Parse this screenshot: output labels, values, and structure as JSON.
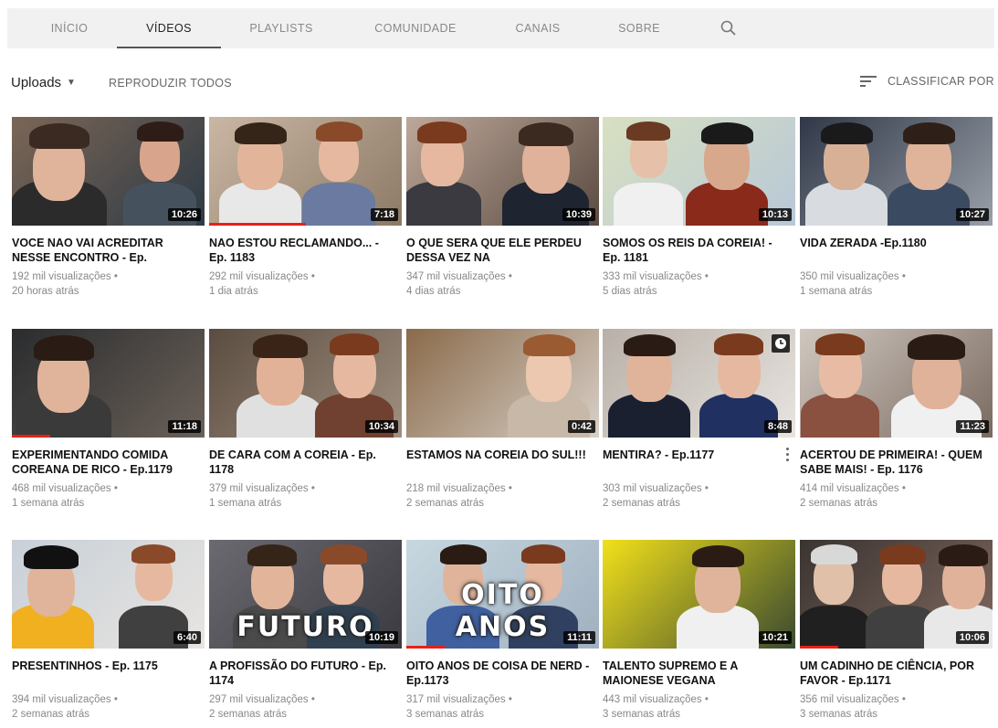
{
  "tabs": [
    {
      "label": "INÍCIO"
    },
    {
      "label": "VÍDEOS"
    },
    {
      "label": "PLAYLISTS"
    },
    {
      "label": "COMUNIDADE"
    },
    {
      "label": "CANAIS"
    },
    {
      "label": "SOBRE"
    }
  ],
  "active_tab": "VÍDEOS",
  "icons": {
    "search": "search-icon",
    "sort": "sort-icon",
    "dropdown": "caret-down-icon"
  },
  "toolbar": {
    "uploads_label": "Uploads",
    "play_all_label": "REPRODUZIR TODOS",
    "sort_label": "CLASSIFICAR POR"
  },
  "colors": {
    "tabbar_bg": "#f1f1f1",
    "progress": "#e62117",
    "duration_bg": "#000000"
  },
  "videos": [
    {
      "title": "VOCE NAO VAI ACREDITAR NESSE ENCONTRO - Ep.",
      "views": "192 mil visualizações •",
      "age": "20 horas atrás",
      "duration": "10:26",
      "watched": 0
    },
    {
      "title": "NAO ESTOU RECLAMANDO... - Ep. 1183",
      "views": "292 mil visualizações •",
      "age": "1 dia atrás",
      "duration": "7:18",
      "watched": 0.5
    },
    {
      "title": "O QUE SERA QUE ELE PERDEU DESSA VEZ NA",
      "views": "347 mil visualizações •",
      "age": "4 dias atrás",
      "duration": "10:39",
      "watched": 0
    },
    {
      "title": "SOMOS OS REIS DA COREIA! - Ep. 1181",
      "views": "333 mil visualizações •",
      "age": "5 dias atrás",
      "duration": "10:13",
      "watched": 0
    },
    {
      "title": "VIDA ZERADA -Ep.1180",
      "views": "350 mil visualizações •",
      "age": "1 semana atrás",
      "duration": "10:27",
      "watched": 0
    },
    {
      "title": "EXPERIMENTANDO COMIDA COREANA DE RICO - Ep.1179",
      "views": "468 mil visualizações •",
      "age": "1 semana atrás",
      "duration": "11:18",
      "watched": 0.2
    },
    {
      "title": "DE CARA COM A COREIA - Ep. 1178",
      "views": "379 mil visualizações •",
      "age": "1 semana atrás",
      "duration": "10:34",
      "watched": 0
    },
    {
      "title": "ESTAMOS NA COREIA DO SUL!!!",
      "views": "218 mil visualizações •",
      "age": "2 semanas atrás",
      "duration": "0:42",
      "watched": 0
    },
    {
      "title": "MENTIRA? - Ep.1177",
      "views": "303 mil visualizações •",
      "age": "2 semanas atrás",
      "duration": "8:48",
      "watched": 0
    },
    {
      "title": "ACERTOU DE PRIMEIRA! - QUEM SABE MAIS! - Ep. 1176",
      "views": "414 mil visualizações •",
      "age": "2 semanas atrás",
      "duration": "11:23",
      "watched": 0
    },
    {
      "title": "PRESENTINHOS - Ep. 1175",
      "views": "394 mil visualizações •",
      "age": "2 semanas atrás",
      "duration": "6:40",
      "watched": 0
    },
    {
      "title": "A PROFISSÃO DO FUTURO - Ep. 1174",
      "views": "297 mil visualizações •",
      "age": "2 semanas atrás",
      "duration": "10:19",
      "watched": 0,
      "overlay": "FUTURO"
    },
    {
      "title": "OITO ANOS DE COISA DE NERD - Ep.1173",
      "views": "317 mil visualizações •",
      "age": "3 semanas atrás",
      "duration": "11:11",
      "watched": 0.2,
      "overlay": "OITO ANOS"
    },
    {
      "title": "TALENTO SUPREMO E A MAIONESE VEGANA",
      "views": "443 mil visualizações •",
      "age": "3 semanas atrás",
      "duration": "10:21",
      "watched": 0
    },
    {
      "title": "UM CADINHO DE CIÊNCIA, POR FAVOR - Ep.1171",
      "views": "356 mil visualizações •",
      "age": "3 semanas atrás",
      "duration": "10:06",
      "watched": 0.2
    }
  ]
}
